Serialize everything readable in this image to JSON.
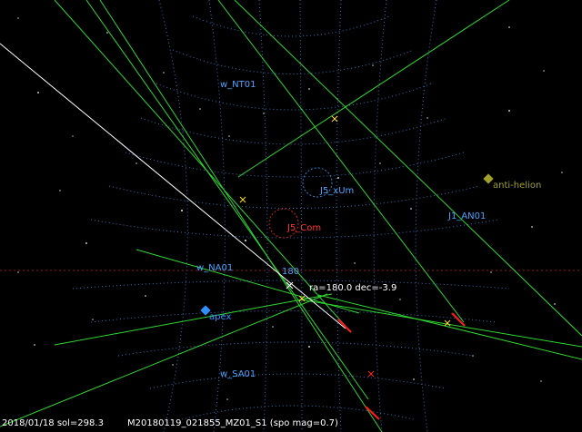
{
  "labels": {
    "w_nt01": "w_NT01",
    "j5_xum": "J5_xUm",
    "anti_helion": "anti-helion",
    "j1_an01": "J1_AN01",
    "j5_com": "J5_Com",
    "w_na01": "w_NA01",
    "radiant_180": "180",
    "ra_dec": "ra=180.0 dec=-3.9",
    "apex": "apex",
    "w_sa01": "w_SA01"
  },
  "footer": {
    "date_sol": "2018/01/18 sol=298.3",
    "capture_id": "M20180119_021855_MZ01_S1 (spo mag=0.7)"
  },
  "colors": {
    "background": "#000000",
    "grid": "#3a7fd0",
    "shower_label": "#4aa3ff",
    "radiant_label": "#ff3333",
    "anti_helion": "#a0a02a",
    "track_green": "#2fd62f",
    "track_white": "#ffffff",
    "meteor_red": "#ff1a1a",
    "apex_marker": "#2f8fff",
    "cross_yellow": "#ffdd33",
    "text": "#ffffff"
  }
}
